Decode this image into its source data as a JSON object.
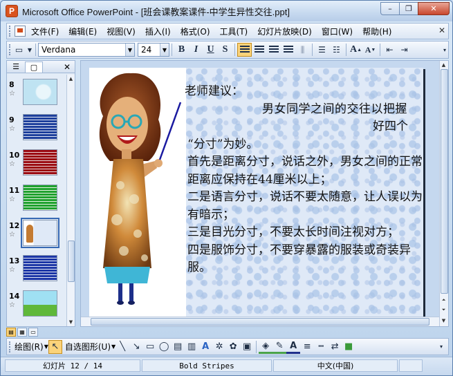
{
  "window": {
    "title": "Microsoft Office PowerPoint - [班会课教案课件-中学生异性交往.ppt]",
    "minimize": "–",
    "restore": "❐",
    "close": "✕"
  },
  "menu": {
    "items": [
      "文件(F)",
      "编辑(E)",
      "视图(V)",
      "插入(I)",
      "格式(O)",
      "工具(T)",
      "幻灯片放映(D)",
      "窗口(W)",
      "帮助(H)"
    ],
    "close": "✕"
  },
  "toolbar": {
    "font_name": "Verdana",
    "font_size": "24",
    "bold": "B",
    "italic": "I",
    "underline": "U",
    "shadow": "S",
    "grow_font": "A",
    "shrink_font": "A"
  },
  "left_panel": {
    "close": "✕",
    "slides": [
      {
        "num": "8",
        "color": "#bfe3f2",
        "accent": "#7ac6e0"
      },
      {
        "num": "9",
        "color": "#1d3f9c",
        "accent": "#f2f2f2"
      },
      {
        "num": "10",
        "color": "#9b0a12",
        "accent": "#e8d6d6"
      },
      {
        "num": "11",
        "color": "#1fa12e",
        "accent": "#e8f3e4"
      },
      {
        "num": "12",
        "color": "#dfe9f7",
        "accent": "#c47b32"
      },
      {
        "num": "13",
        "color": "#1c36a6",
        "accent": "#e4e9f5"
      },
      {
        "num": "14",
        "color": "#9fe0f3",
        "accent": "#5fb83a"
      }
    ],
    "star": "☆"
  },
  "slide": {
    "heading": "老师建议：",
    "lines": [
      "男女同学之间的交往以把握",
      "好四个",
      "“分寸”为妙。",
      "首先是距离分寸，说话之外，男女之间的正常距离应保持在44厘米以上；",
      "二是语言分寸，说话不要太随意，让人误以为有暗示；",
      "三是目光分寸，不要太长时间注视对方；",
      "四是服饰分寸，不要穿暴露的服装或奇装异服。"
    ]
  },
  "drawing_toolbar": {
    "draw_label": "绘图(R)",
    "autoshapes_label": "自选图形(U)"
  },
  "status": {
    "slide_info": "幻灯片 12 / 14",
    "design": "Bold Stripes",
    "language": "中文(中国)"
  }
}
